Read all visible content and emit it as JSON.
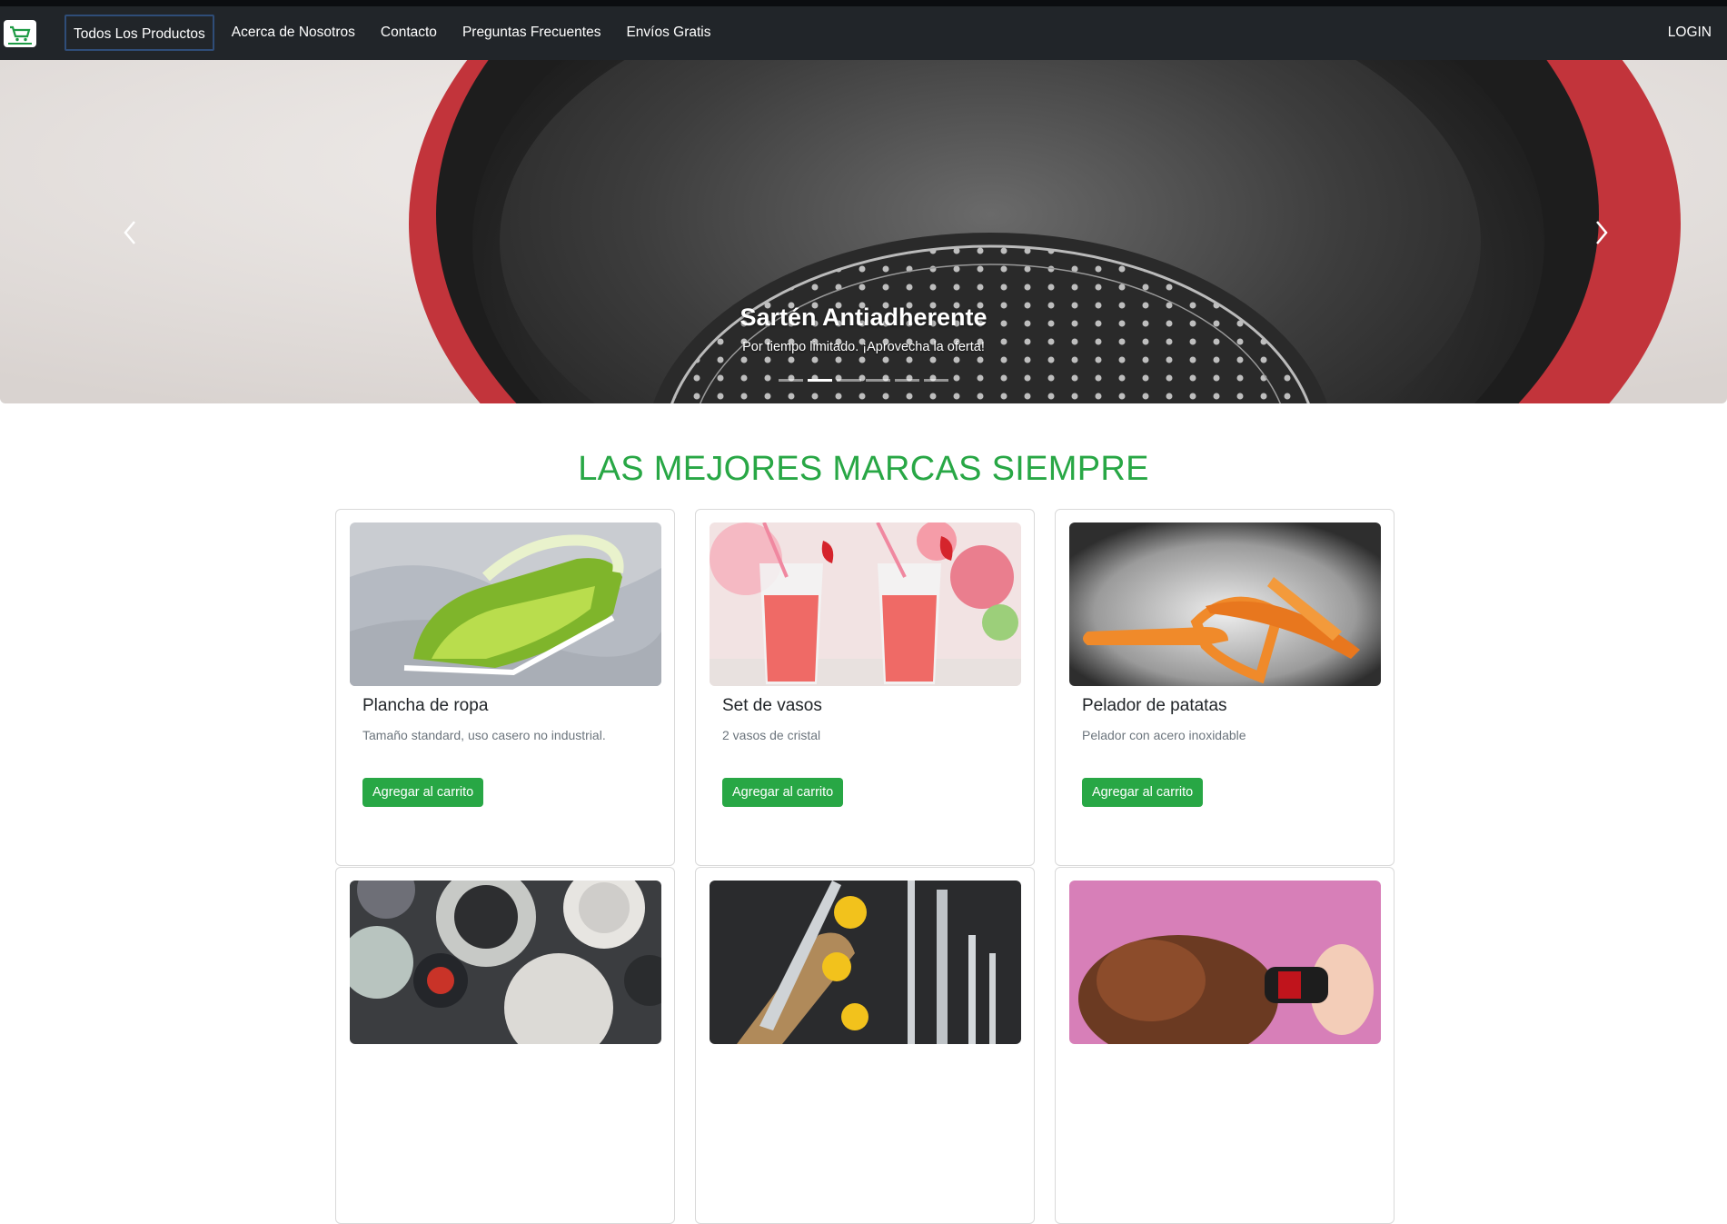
{
  "navbar": {
    "brand_icon": "shop-now-cart-logo",
    "links": [
      {
        "label": "Todos Los Productos",
        "active": true
      },
      {
        "label": "Acerca de Nosotros"
      },
      {
        "label": "Contacto"
      },
      {
        "label": "Preguntas Frecuentes"
      },
      {
        "label": "Envíos Gratis"
      }
    ],
    "login_label": "LOGIN"
  },
  "carousel": {
    "title": "Sartén Antiadherente",
    "text": "Por tiempo limitado. ¡Aprovecha la oferta!",
    "slide_count": 6,
    "active_index": 1,
    "prev_icon": "chevron-left-icon",
    "next_icon": "chevron-right-icon"
  },
  "headline": "LAS MEJORES MARCAS SIEMPRE",
  "products": [
    {
      "title": "Plancha de ropa",
      "description": "Tamaño standard, uso casero no industrial.",
      "button": "Agregar al carrito"
    },
    {
      "title": "Set de vasos",
      "description": "2 vasos de cristal",
      "button": "Agregar al carrito"
    },
    {
      "title": "Pelador de patatas",
      "description": "Pelador con acero inoxidable",
      "button": "Agregar al carrito"
    },
    {
      "title": "",
      "description": "",
      "button": ""
    },
    {
      "title": "",
      "description": "",
      "button": ""
    },
    {
      "title": "",
      "description": "",
      "button": ""
    }
  ],
  "colors": {
    "navbar_bg": "#212529",
    "accent_green": "#28a745",
    "active_outline": "#2f4d78"
  }
}
